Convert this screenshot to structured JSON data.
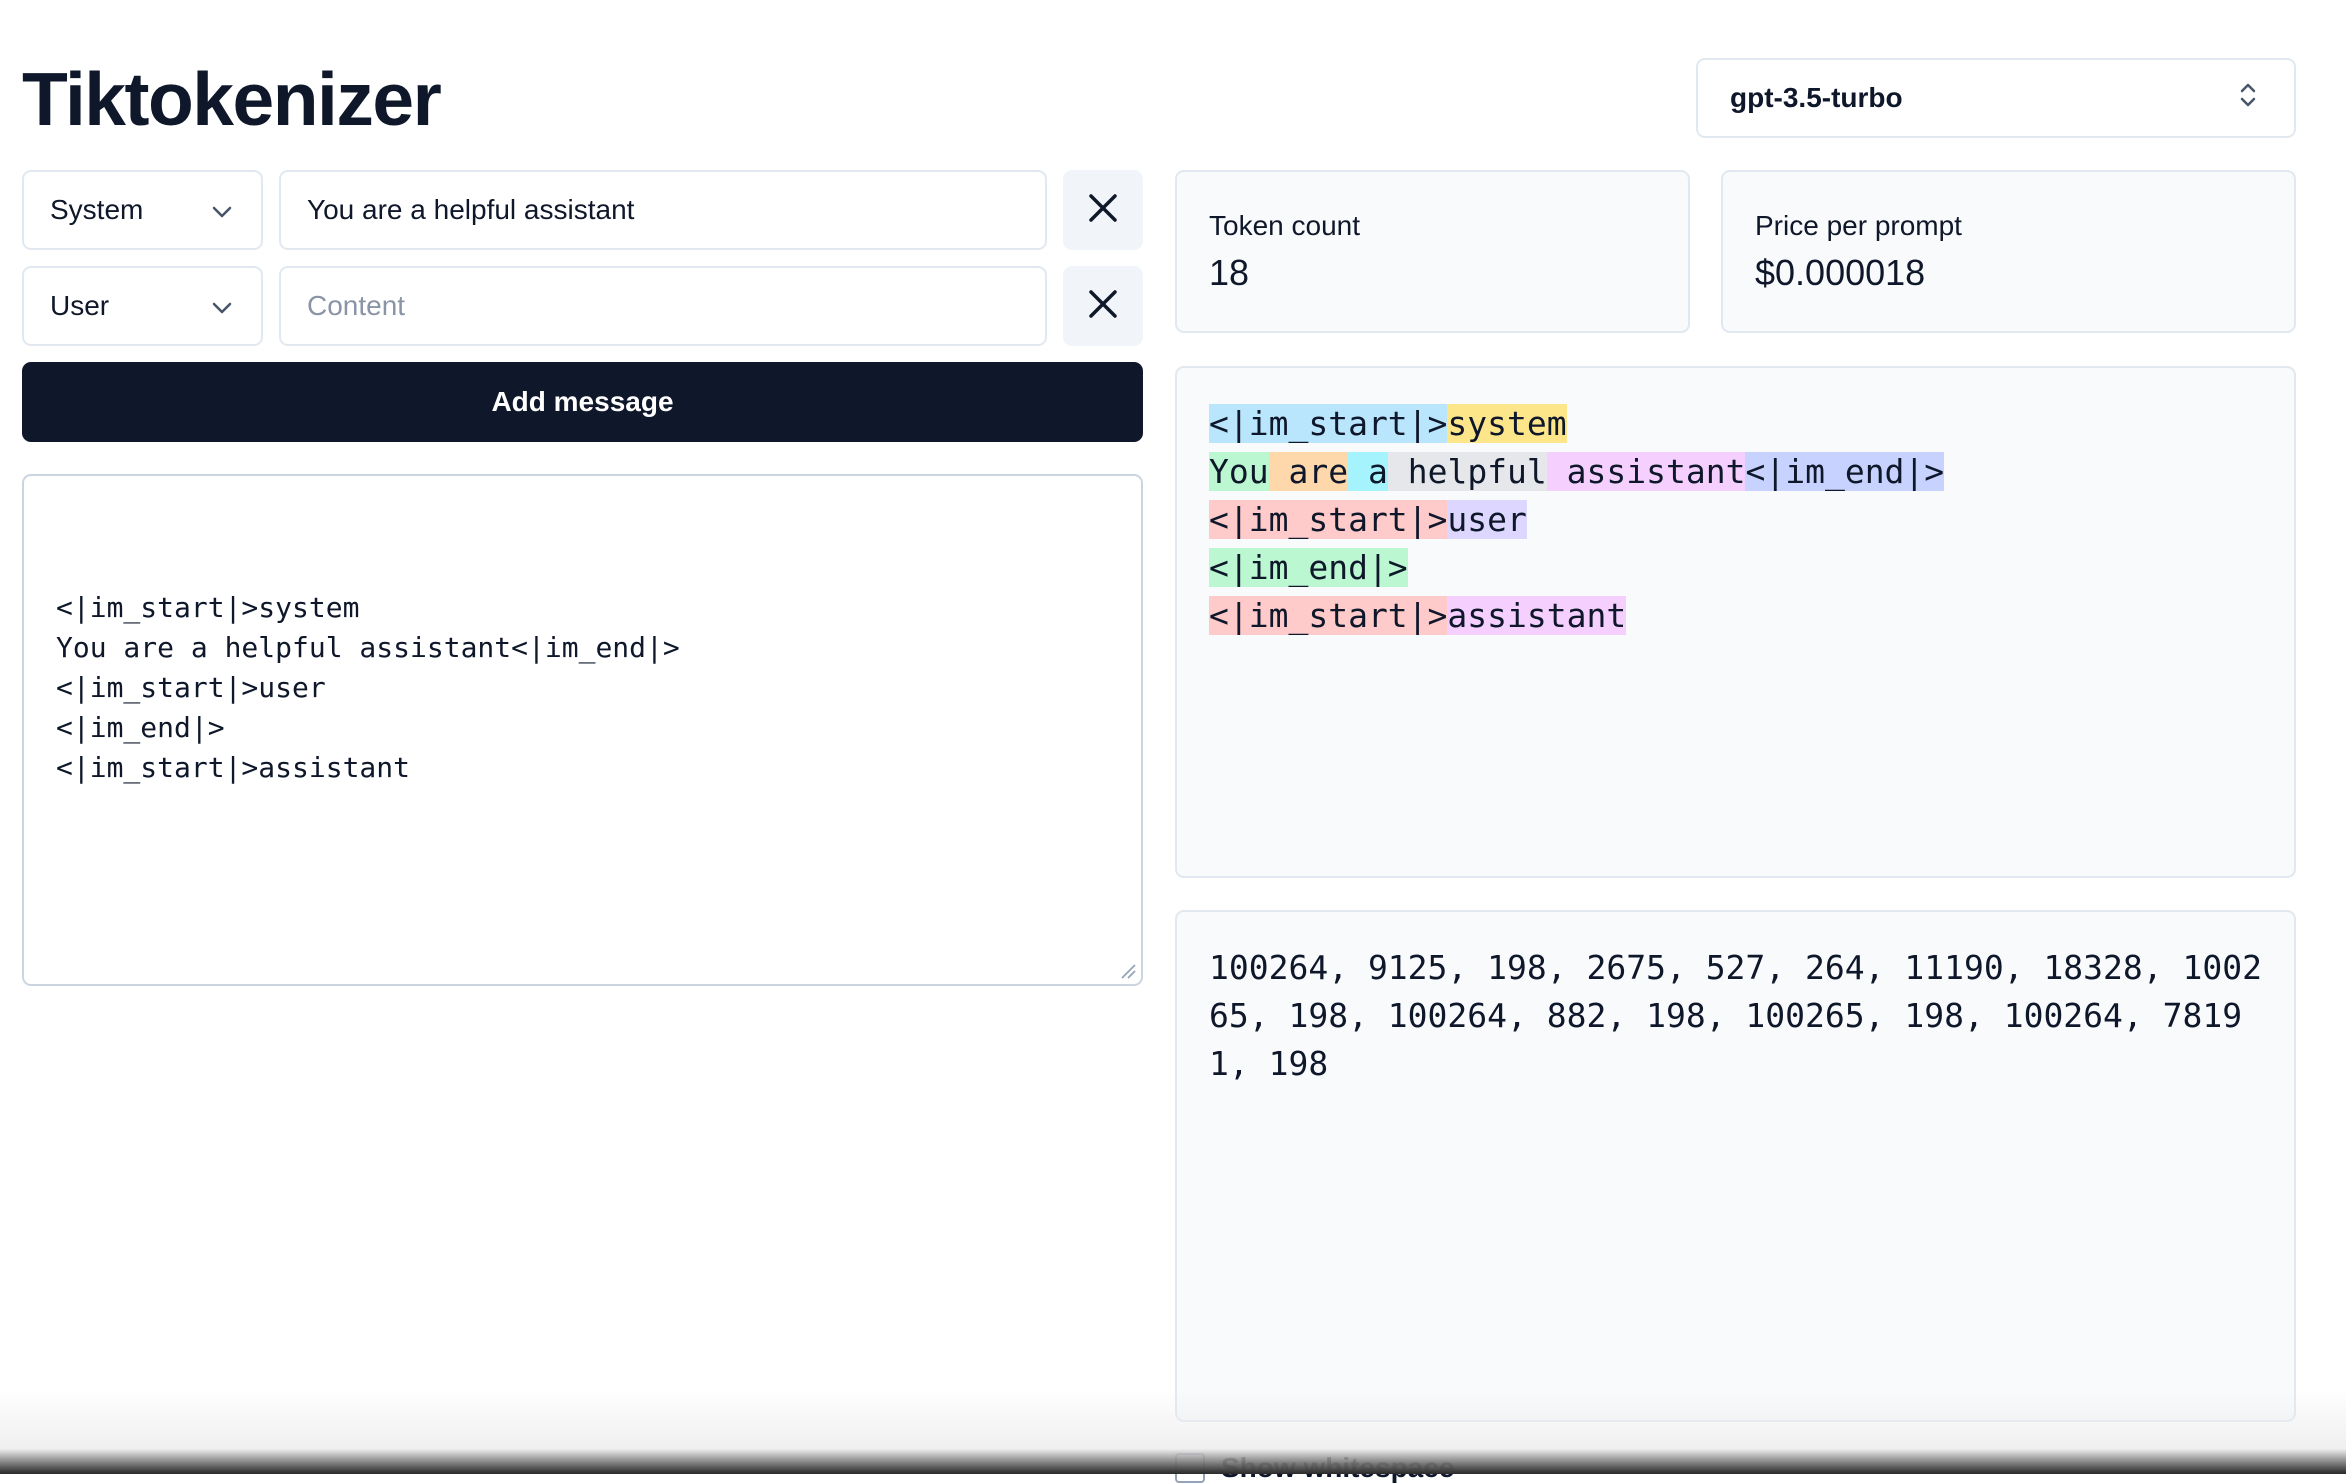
{
  "title": "Tiktokenizer",
  "model_select": {
    "value": "gpt-3.5-turbo",
    "icon": "chevron-up-down-icon"
  },
  "messages": [
    {
      "role": "System",
      "content": "You are a helpful assistant",
      "placeholder": "Content"
    },
    {
      "role": "User",
      "content": "",
      "placeholder": "Content"
    }
  ],
  "add_message_label": "Add message",
  "prompt_text": "<|im_start|>system\nYou are a helpful assistant<|im_end|>\n<|im_start|>user\n<|im_end|>\n<|im_start|>assistant",
  "stats": {
    "token_count_label": "Token count",
    "token_count_value": "18",
    "price_label": "Price per prompt",
    "price_value": "$0.000018"
  },
  "token_lines": [
    [
      {
        "text": "<|im_start|>",
        "color": "#bae6fd"
      },
      {
        "text": "system",
        "color": "#fde68a"
      }
    ],
    [
      {
        "text": "You",
        "color": "#bbf7d0"
      },
      {
        "text": " are",
        "color": "#fed7aa"
      },
      {
        "text": " a",
        "color": "#a5f3fc"
      },
      {
        "text": " helpful",
        "color": "#e5e7eb"
      },
      {
        "text": " assistant",
        "color": "#f5d0fe"
      },
      {
        "text": "<|im_end|>",
        "color": "#c7d2fe"
      }
    ],
    [
      {
        "text": "<|im_start|>",
        "color": "#fecaca"
      },
      {
        "text": "user",
        "color": "#ddd6fe"
      }
    ],
    [
      {
        "text": "<|im_end|>",
        "color": "#bbf7d0"
      }
    ],
    [
      {
        "text": "<|im_start|>",
        "color": "#fecaca"
      },
      {
        "text": "assistant",
        "color": "#f5d0fe"
      }
    ]
  ],
  "token_ids_text": "100264, 9125, 198, 2675, 527, 264, 11190, 18328, 100265, 198, 100264, 882, 198, 100265, 198, 100264, 78191, 198",
  "show_whitespace_label": "Show whitespace"
}
